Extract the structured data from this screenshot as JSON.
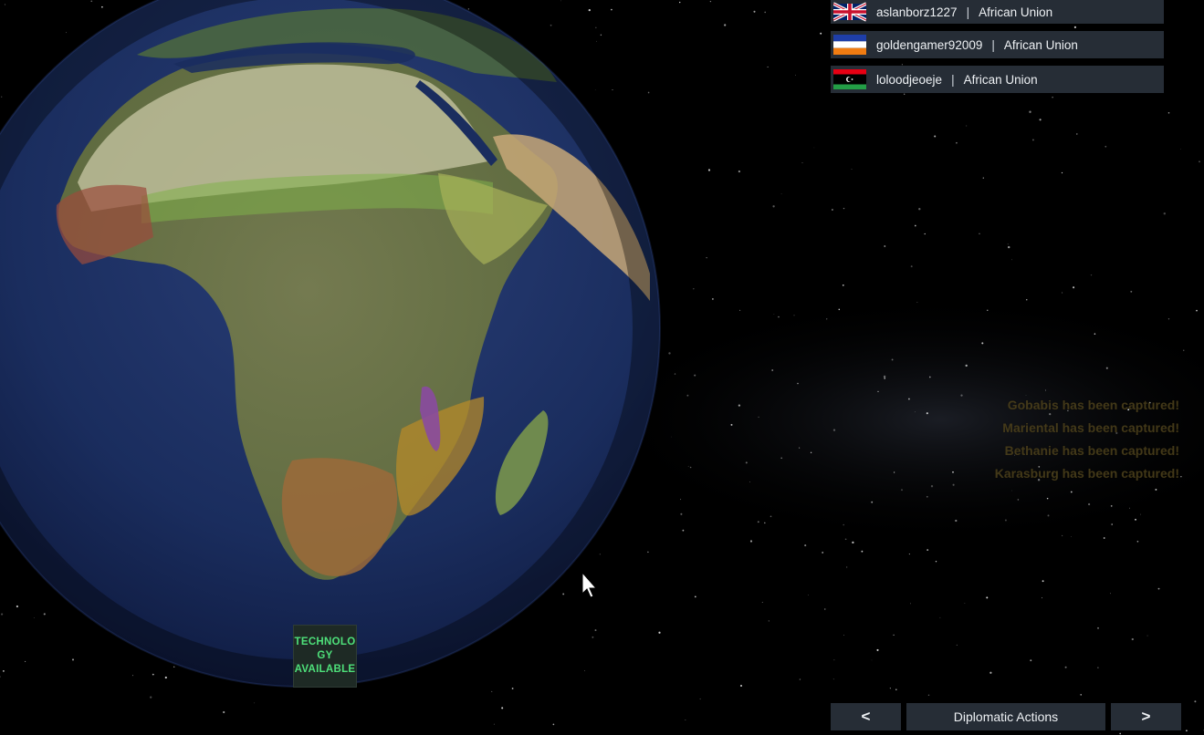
{
  "players": [
    {
      "name": "aslanborz1227",
      "faction": "African Union",
      "flag": "uk-flag"
    },
    {
      "name": "goldengamer92009",
      "faction": "African Union",
      "flag": "orange-white-blue-flag"
    },
    {
      "name": "loloodjeoeje",
      "faction": "African Union",
      "flag": "libya-flag"
    }
  ],
  "separator": "|",
  "tech_badge": {
    "line1": "TECHNOLO",
    "line2": "GY",
    "line3": "AVAILABLE"
  },
  "capture_log": [
    "Gobabis has been captured!",
    "Mariental has been captured!",
    "Bethanie has been captured!",
    "Karasburg has been captured!"
  ],
  "nav": {
    "prev_label": "<",
    "main_label": "Diplomatic Actions",
    "next_label": ">"
  },
  "colors": {
    "panel_bg": "#262d36",
    "tech_text": "#4ee07a",
    "ocean": "#1a2d5e",
    "land": "#6f7d4c"
  }
}
